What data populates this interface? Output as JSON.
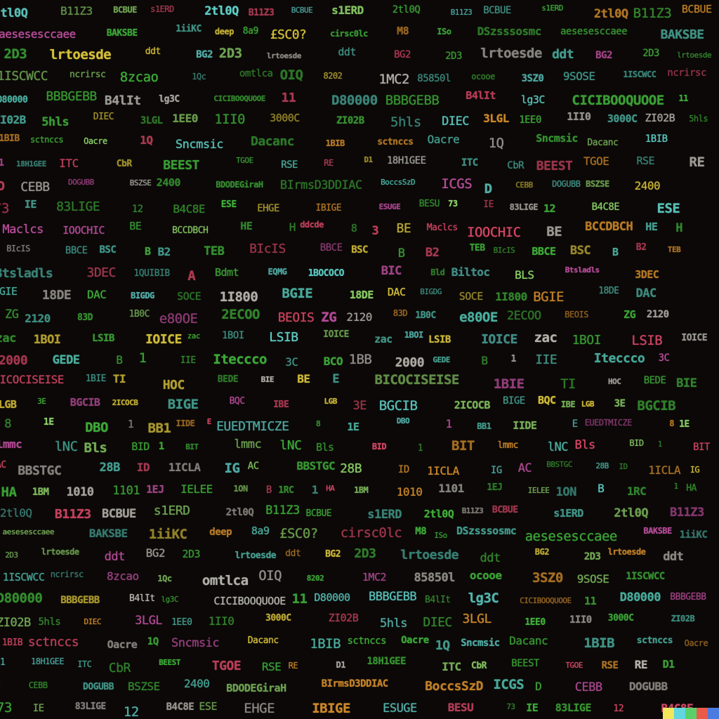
{
  "palette": {
    "background": "#0b0807",
    "green": "#3fae3a",
    "light_green": "#8fd46a",
    "teal": "#4bb0a0",
    "cyan": "#5fd0c8",
    "yellow": "#d8c23a",
    "orange": "#d08a2a",
    "pink": "#e04a6a",
    "magenta": "#c050a0",
    "gray": "#b8b8b0"
  },
  "color_bar": [
    "#f2e65a",
    "#5fd6e0",
    "#5ad06a",
    "#ea5a4a",
    "#4a7be0"
  ],
  "glyph_rows": [
    [
      "2tl0Q",
      "B11Z3",
      "BCBUE",
      "s1ERD"
    ],
    [
      "aesesesccaee",
      "BAKSBE",
      "1iiKC",
      "deep",
      "8a9",
      "£SC0?",
      "cirsc0lc",
      "M8",
      "ISo",
      "DSzsssosmc"
    ],
    [
      "2D3",
      "lrtoesde",
      "ddt",
      "BG2"
    ],
    [
      "1ISCWCC",
      "ncrirsc",
      "8zcao",
      "1Qc",
      "omtlca",
      "OIQ",
      "8202",
      "1MC2",
      "85850l",
      "ocooe",
      "3SZ0",
      "9SOSE"
    ],
    [
      "D80000",
      "BBBGEBB",
      "B4lIt",
      "lg3C",
      "CICIBOOQUOOE",
      "11"
    ],
    [
      "ZI02B",
      "5hls",
      "DIEC",
      "3LGL",
      "1EE0",
      "1II0",
      "3000C"
    ],
    [
      "1BIB",
      "sctnccs",
      "Oacre",
      "1Q",
      "Sncmsic",
      "Dacanc"
    ],
    [
      "D1",
      "18H1GEE",
      "ITC",
      "CbR",
      "BEEST",
      "TGOE",
      "RSE",
      "RE"
    ],
    [
      "D",
      "CEBB",
      "DOGUBB",
      "BSZSE",
      "2400",
      "BDODEGiraH",
      "BIrmsD3DDIAC",
      "BoccsSzD",
      "ICGS"
    ],
    [
      "73",
      "IE",
      "83LIGE",
      "12",
      "B4C8E",
      "ESE",
      "EHGE",
      "IBIGE",
      "ESUGE",
      "BESU"
    ],
    [
      "Maclcs",
      "IOOCHIC",
      "BE",
      "BCCDBCH",
      "HE",
      "H",
      "ddcde",
      "8",
      "3",
      "BE"
    ],
    [
      "BIcIS",
      "BBCE",
      "BSC",
      "B",
      "B2",
      "TEB"
    ],
    [
      "Btsladls",
      "3DEC",
      "1QUIBIB",
      "A",
      "Bdmt",
      "EQMG",
      "1BOCOCO",
      "BIC",
      "Bld",
      "Biltoc",
      "BLS"
    ],
    [
      "BGIE",
      "18DE",
      "DAC",
      "BIGDG",
      "SOCE",
      "1I800"
    ],
    [
      "ZG",
      "2120",
      "83D",
      "1B0C",
      "e80OE",
      "2ECOO",
      "BEOIS"
    ],
    [
      "zac",
      "1BOI",
      "LSIB",
      "IOICE"
    ],
    [
      "2000",
      "GEDE",
      "B",
      "1",
      "IIE",
      "Iteccco",
      "3C",
      "BCO",
      "1BB"
    ],
    [
      "BICOCISEISE",
      "1BIE",
      "TI",
      "HOC",
      "BEDE",
      "BIE",
      "BE",
      "E"
    ],
    [
      "LGB",
      "3E",
      "BGCIB",
      "2ICOCB",
      "BIGE",
      "BQC",
      "IBE"
    ],
    [
      "8",
      "1E",
      "DBO",
      "1",
      "BB1",
      "IIDE",
      "E",
      "EUEDTMICZE"
    ],
    [
      "lmmc",
      "lNC",
      "Bls",
      "BID",
      "1",
      "BIT"
    ],
    [
      "AC",
      "BBSTGC",
      "28B",
      "ID",
      "1ICLA",
      "IG"
    ]
  ],
  "bottom_row": [
    "HA",
    "1BM",
    "1010",
    "1101",
    "1EJ",
    "IELEE",
    "1ON",
    "B",
    "1RC",
    "1"
  ]
}
